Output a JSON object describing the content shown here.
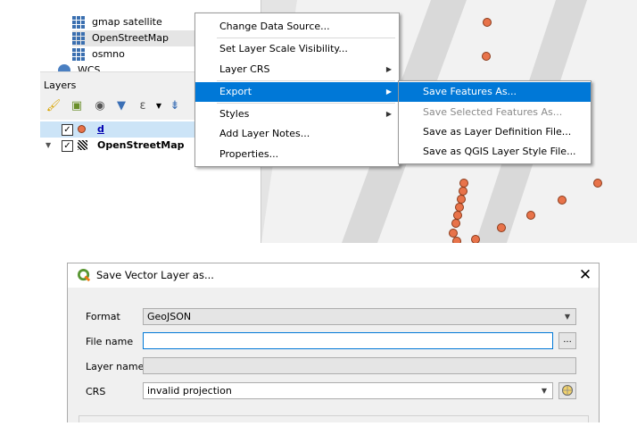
{
  "browser": {
    "items": [
      {
        "label": "gmap satellite",
        "icon": "grid-icon"
      },
      {
        "label": "OpenStreetMap",
        "icon": "grid-icon"
      },
      {
        "label": "osmno",
        "icon": "grid-icon"
      },
      {
        "label": "WCS",
        "icon": "globe-icon"
      }
    ]
  },
  "layers_panel": {
    "title": "Layers",
    "toolbar_icons": [
      "style-brush-icon",
      "add-group-icon",
      "eye-icon",
      "filter-icon",
      "expression-filter-icon",
      "chevron-down-icon",
      "collapse-all-icon"
    ],
    "tree": [
      {
        "name": "d",
        "checked": true,
        "selected": true,
        "icon": "point-layer-icon"
      },
      {
        "name": "OpenStreetMap",
        "checked": true,
        "selected": false,
        "icon": "raster-layer-icon"
      }
    ]
  },
  "context_menu": {
    "items": [
      {
        "label": "Change Data Source..."
      },
      {
        "label": "Set Layer Scale Visibility..."
      },
      {
        "label": "Layer CRS",
        "submenu": true
      },
      {
        "label": "Export",
        "submenu": true,
        "highlighted": true
      },
      {
        "label": "Styles",
        "submenu": true
      },
      {
        "label": "Add Layer Notes..."
      },
      {
        "label": "Properties..."
      }
    ]
  },
  "export_submenu": {
    "items": [
      {
        "label": "Save Features As...",
        "highlighted": true
      },
      {
        "label": "Save Selected Features As...",
        "disabled": true
      },
      {
        "label": "Save as Layer Definition File..."
      },
      {
        "label": "Save as QGIS Layer Style File..."
      }
    ]
  },
  "dialog": {
    "title": "Save Vector Layer as...",
    "close_glyph": "✕",
    "format_label": "Format",
    "format_value": "GeoJSON",
    "filename_label": "File name",
    "filename_value": "",
    "browse_label": "...",
    "layername_label": "Layer name",
    "layername_value": "",
    "crs_label": "CRS",
    "crs_value": "invalid projection"
  },
  "colors": {
    "highlight": "#0078d7",
    "point_fill": "#e8734a",
    "selection_bg": "#cce4f7"
  }
}
